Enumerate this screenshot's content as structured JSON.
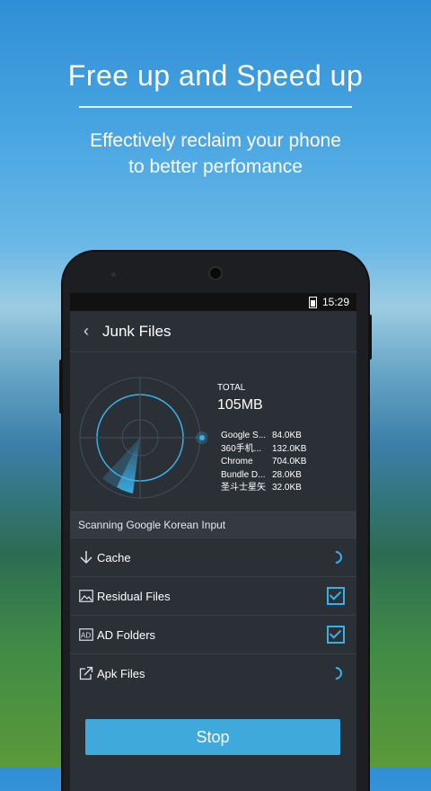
{
  "promo": {
    "title": "Free up and Speed up",
    "subtitle_line1": "Effectively reclaim your phone",
    "subtitle_line2": "to better perfomance"
  },
  "status_bar": {
    "time": "15:29"
  },
  "app_bar": {
    "title": "Junk Files"
  },
  "summary": {
    "total_label": "TOTAL",
    "total_value": "105MB",
    "items": [
      {
        "name": "Google S...",
        "size": "84.0KB"
      },
      {
        "name": "360手机...",
        "size": "132.0KB"
      },
      {
        "name": "Chrome",
        "size": "704.0KB"
      },
      {
        "name": "Bundle D...",
        "size": "28.0KB"
      },
      {
        "name": "圣斗士星矢",
        "size": "32.0KB"
      }
    ]
  },
  "scanning_text": "Scanning Google Korean Input",
  "categories": [
    {
      "label": "Cache",
      "icon": "download-arrow-icon",
      "status": "scanning"
    },
    {
      "label": "Residual Files",
      "icon": "image-icon",
      "status": "checked"
    },
    {
      "label": "AD Folders",
      "icon": "ad-icon",
      "status": "checked"
    },
    {
      "label": "Apk Files",
      "icon": "external-link-icon",
      "status": "scanning"
    }
  ],
  "stop_label": "Stop",
  "colors": {
    "accent": "#3fa9dc",
    "panel": "#2b3037"
  }
}
